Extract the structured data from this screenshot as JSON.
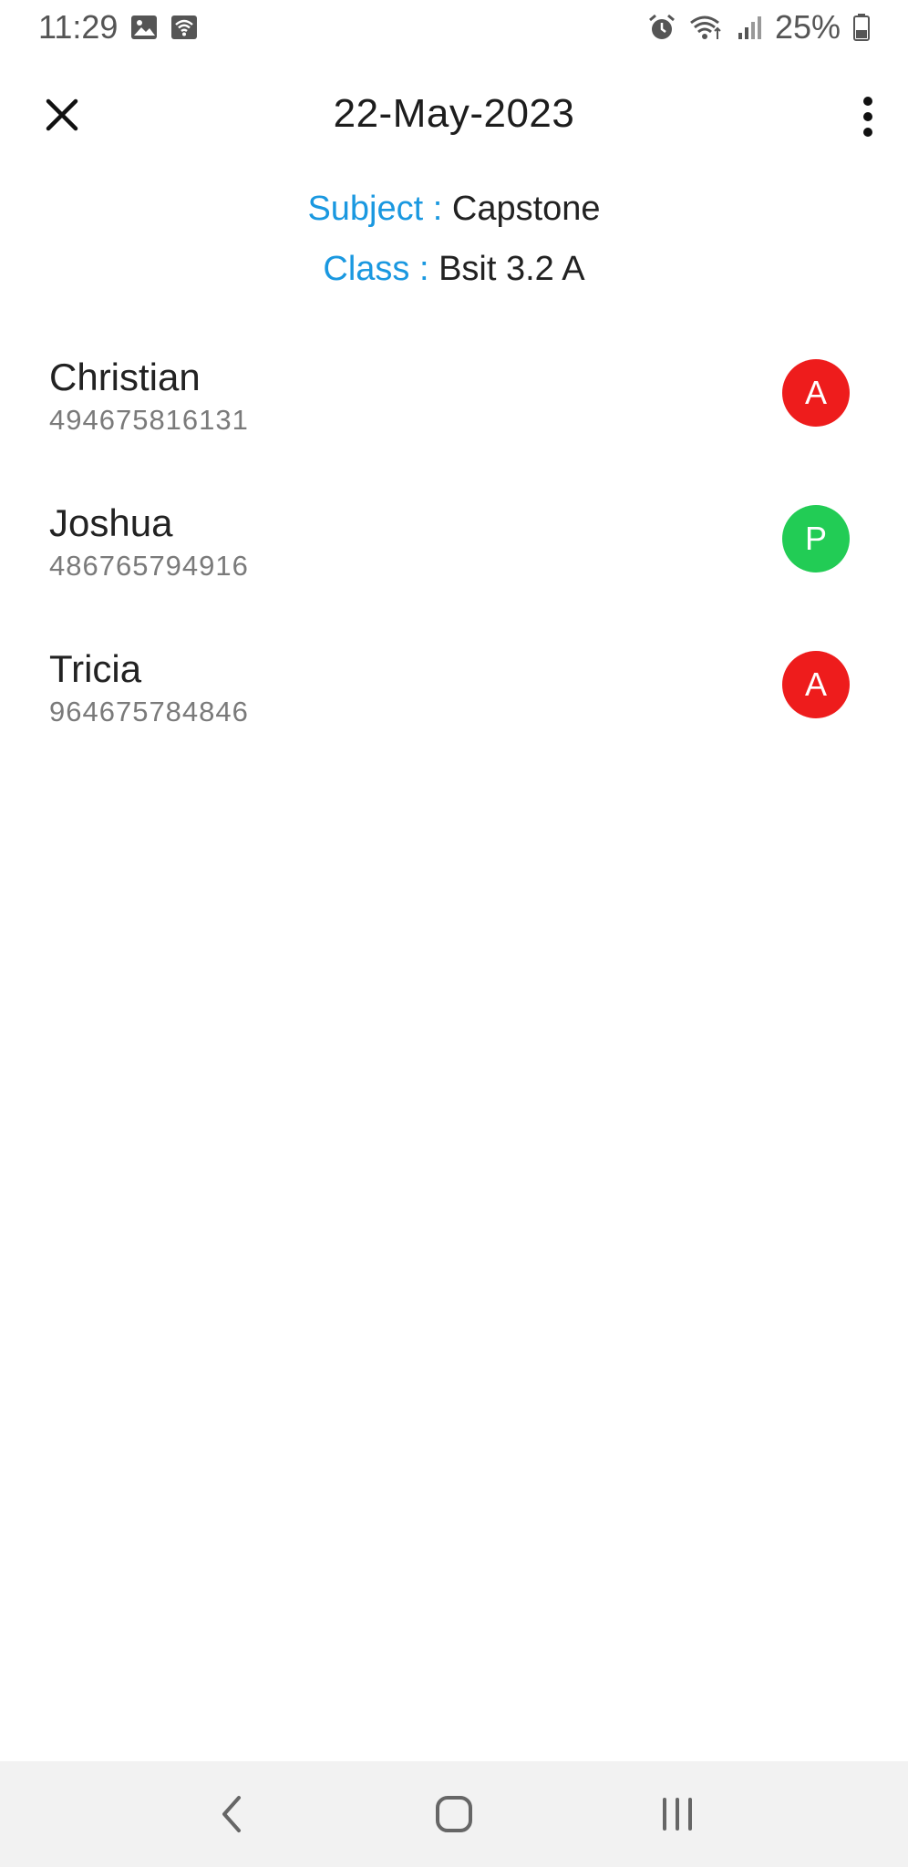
{
  "status_bar": {
    "time": "11:29",
    "battery": "25%",
    "icons": [
      "image-icon",
      "wifi-hotspot-icon",
      "alarm-icon",
      "wifi-icon",
      "signal-icon",
      "battery-icon"
    ]
  },
  "header": {
    "title": "22-May-2023",
    "close_icon": "close-icon",
    "menu_icon": "more-vert-icon"
  },
  "info": {
    "subject_label": "Subject :",
    "subject_value": "Capstone",
    "class_label": "Class :",
    "class_value": "Bsit 3.2 A"
  },
  "students": [
    {
      "name": "Christian",
      "id": "494675816131",
      "status": "A",
      "status_color": "#ee1c1c"
    },
    {
      "name": "Joshua",
      "id": "486765794916",
      "status": "P",
      "status_color": "#22cc55"
    },
    {
      "name": "Tricia",
      "id": "964675784846",
      "status": "A",
      "status_color": "#ee1c1c"
    }
  ],
  "colors": {
    "accent": "#1a98e0",
    "absent": "#ee1c1c",
    "present": "#22cc55",
    "nav_bar_bg": "#f2f2f2"
  },
  "nav_bar": {
    "icons": [
      "back-icon",
      "home-icon",
      "recents-icon"
    ]
  }
}
